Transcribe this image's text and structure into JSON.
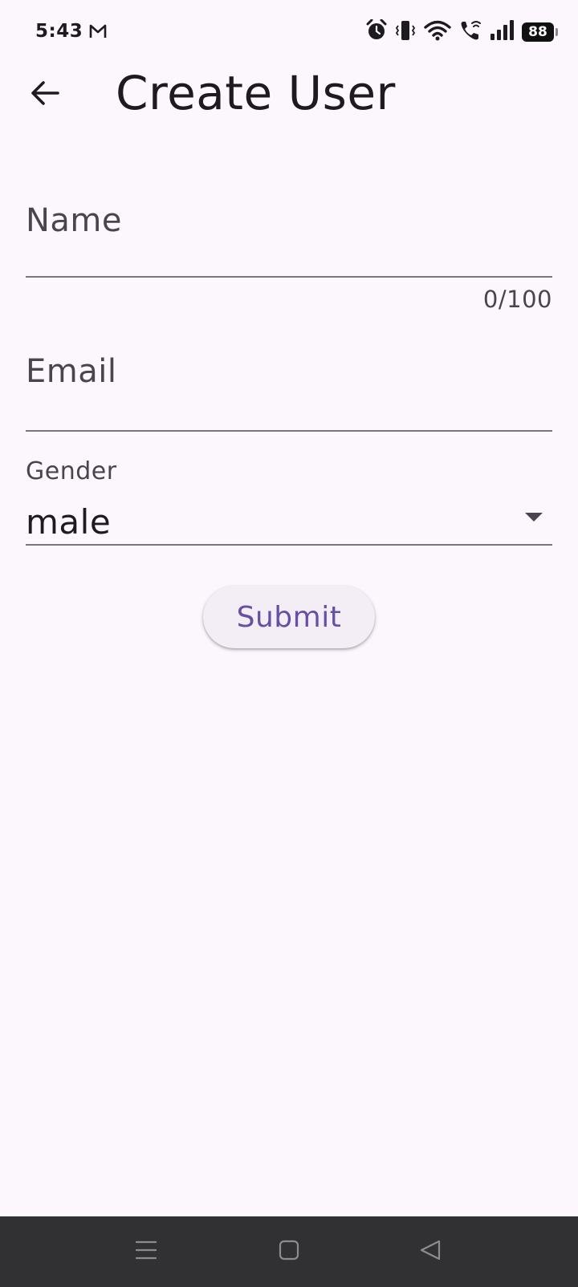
{
  "status_bar": {
    "time": "5:43",
    "battery": "88",
    "icons": [
      "gmail-icon",
      "alarm-icon",
      "vibrate-icon",
      "wifi-icon",
      "wifi-call-icon",
      "signal-icon",
      "battery-icon"
    ]
  },
  "app_bar": {
    "title": "Create User",
    "back_icon": "arrow-back-icon"
  },
  "form": {
    "name": {
      "label": "Name",
      "value": "",
      "counter": "0/100"
    },
    "email": {
      "label": "Email",
      "value": ""
    },
    "gender": {
      "label": "Gender",
      "selected": "male"
    },
    "submit_label": "Submit"
  },
  "nav_bar": {
    "icons": [
      "menu-icon",
      "home-icon",
      "back-triangle-icon"
    ]
  },
  "colors": {
    "background": "#fcf7fd",
    "accent": "#6750a4",
    "button_bg": "#f3edf5",
    "nav_bg": "#313033",
    "underline": "#79747e"
  }
}
